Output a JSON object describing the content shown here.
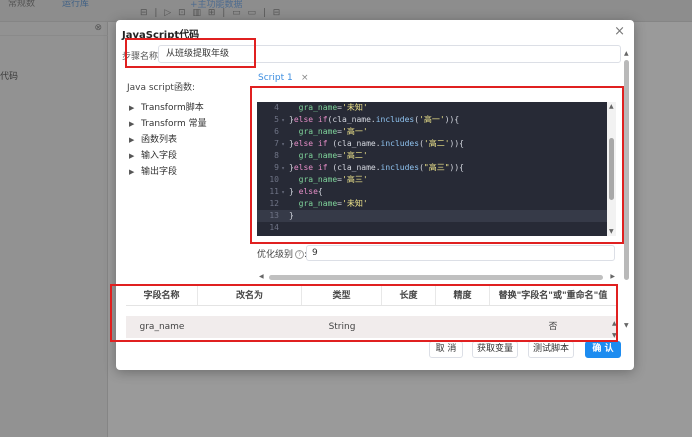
{
  "background": {
    "tabs": [
      "常规数",
      "运行库"
    ],
    "link": "+主功能数据",
    "sidebar_close": "⊗",
    "sidebar_label": "代码",
    "toolbar": "⊟ | ▷ ⊡ ▥ ⊞ | ▭ ▭ | ⊟"
  },
  "dialog": {
    "title": "JavaScript代码",
    "close_symbol": "×",
    "step_label": "步骤名称:",
    "step_value": "从班级提取年级",
    "js_functions_label": "Java script函数:",
    "tree": [
      {
        "arrow": "▶",
        "label": "Transform脚本"
      },
      {
        "arrow": "▶",
        "label": "Transform 常量"
      },
      {
        "arrow": "▶",
        "label": "函数列表"
      },
      {
        "arrow": "▶",
        "label": "输入字段"
      },
      {
        "arrow": "▶",
        "label": "输出字段"
      }
    ],
    "script_tab": "Script 1",
    "script_tab_close": "×",
    "code_lines": [
      {
        "ln": "4",
        "fold": "",
        "parts": [
          {
            "t": "  ",
            "c": ""
          },
          {
            "t": "gra_name",
            "c": "c-var"
          },
          {
            "t": "=",
            "c": ""
          },
          {
            "t": "'未知'",
            "c": "c-str"
          }
        ]
      },
      {
        "ln": "5",
        "fold": "▾",
        "parts": [
          {
            "t": "}",
            "c": ""
          },
          {
            "t": "else if",
            "c": "c-kw"
          },
          {
            "t": "(cla_name.",
            "c": ""
          },
          {
            "t": "includes",
            "c": "c-fn"
          },
          {
            "t": "(",
            "c": ""
          },
          {
            "t": "'高一'",
            "c": "c-str"
          },
          {
            "t": ")){",
            "c": ""
          }
        ]
      },
      {
        "ln": "6",
        "fold": "",
        "parts": [
          {
            "t": "  ",
            "c": ""
          },
          {
            "t": "gra_name",
            "c": "c-var"
          },
          {
            "t": "=",
            "c": ""
          },
          {
            "t": "'高一'",
            "c": "c-str"
          }
        ]
      },
      {
        "ln": "7",
        "fold": "▾",
        "parts": [
          {
            "t": "}",
            "c": ""
          },
          {
            "t": "else if",
            "c": "c-kw"
          },
          {
            "t": " (cla_name.",
            "c": ""
          },
          {
            "t": "includes",
            "c": "c-fn"
          },
          {
            "t": "(",
            "c": ""
          },
          {
            "t": "'高二'",
            "c": "c-str"
          },
          {
            "t": ")){",
            "c": ""
          }
        ]
      },
      {
        "ln": "8",
        "fold": "",
        "parts": [
          {
            "t": "  ",
            "c": ""
          },
          {
            "t": "gra_name",
            "c": "c-var"
          },
          {
            "t": "=",
            "c": ""
          },
          {
            "t": "'高二'",
            "c": "c-str"
          }
        ]
      },
      {
        "ln": "9",
        "fold": "▾",
        "parts": [
          {
            "t": "}",
            "c": ""
          },
          {
            "t": "else if",
            "c": "c-kw"
          },
          {
            "t": " (cla_name.",
            "c": ""
          },
          {
            "t": "includes",
            "c": "c-fn"
          },
          {
            "t": "(",
            "c": ""
          },
          {
            "t": "\"高三\"",
            "c": "c-str"
          },
          {
            "t": ")){",
            "c": ""
          }
        ]
      },
      {
        "ln": "10",
        "fold": "",
        "parts": [
          {
            "t": "  ",
            "c": ""
          },
          {
            "t": "gra_name",
            "c": "c-var"
          },
          {
            "t": "=",
            "c": ""
          },
          {
            "t": "'高三'",
            "c": "c-str"
          }
        ]
      },
      {
        "ln": "11",
        "fold": "▾",
        "parts": [
          {
            "t": "} ",
            "c": ""
          },
          {
            "t": "else",
            "c": "c-kw"
          },
          {
            "t": "{",
            "c": ""
          }
        ]
      },
      {
        "ln": "12",
        "fold": "",
        "parts": [
          {
            "t": "  ",
            "c": ""
          },
          {
            "t": "gra_name",
            "c": "c-var"
          },
          {
            "t": "=",
            "c": ""
          },
          {
            "t": "'未知'",
            "c": "c-str"
          }
        ]
      },
      {
        "ln": "13",
        "fold": "",
        "parts": [
          {
            "t": "}",
            "c": ""
          }
        ],
        "active": true
      },
      {
        "ln": "14",
        "fold": "",
        "parts": []
      }
    ],
    "opt_label": "优化级别",
    "opt_value": "9",
    "table": {
      "headers": [
        "字段名称",
        "改名为",
        "类型",
        "长度",
        "精度",
        "替换\"字段名\"或\"重命名\"值"
      ],
      "rows": [
        [
          "gra_name",
          "",
          "String",
          "",
          "",
          "否"
        ]
      ]
    },
    "buttons": {
      "cancel": "取 消",
      "get_vars": "获取变量",
      "test": "测试脚本",
      "ok": "确 认"
    }
  },
  "colors": {
    "primary": "#1d8cf0",
    "annotation": "#e02020",
    "editor_bg": "#272a36"
  }
}
